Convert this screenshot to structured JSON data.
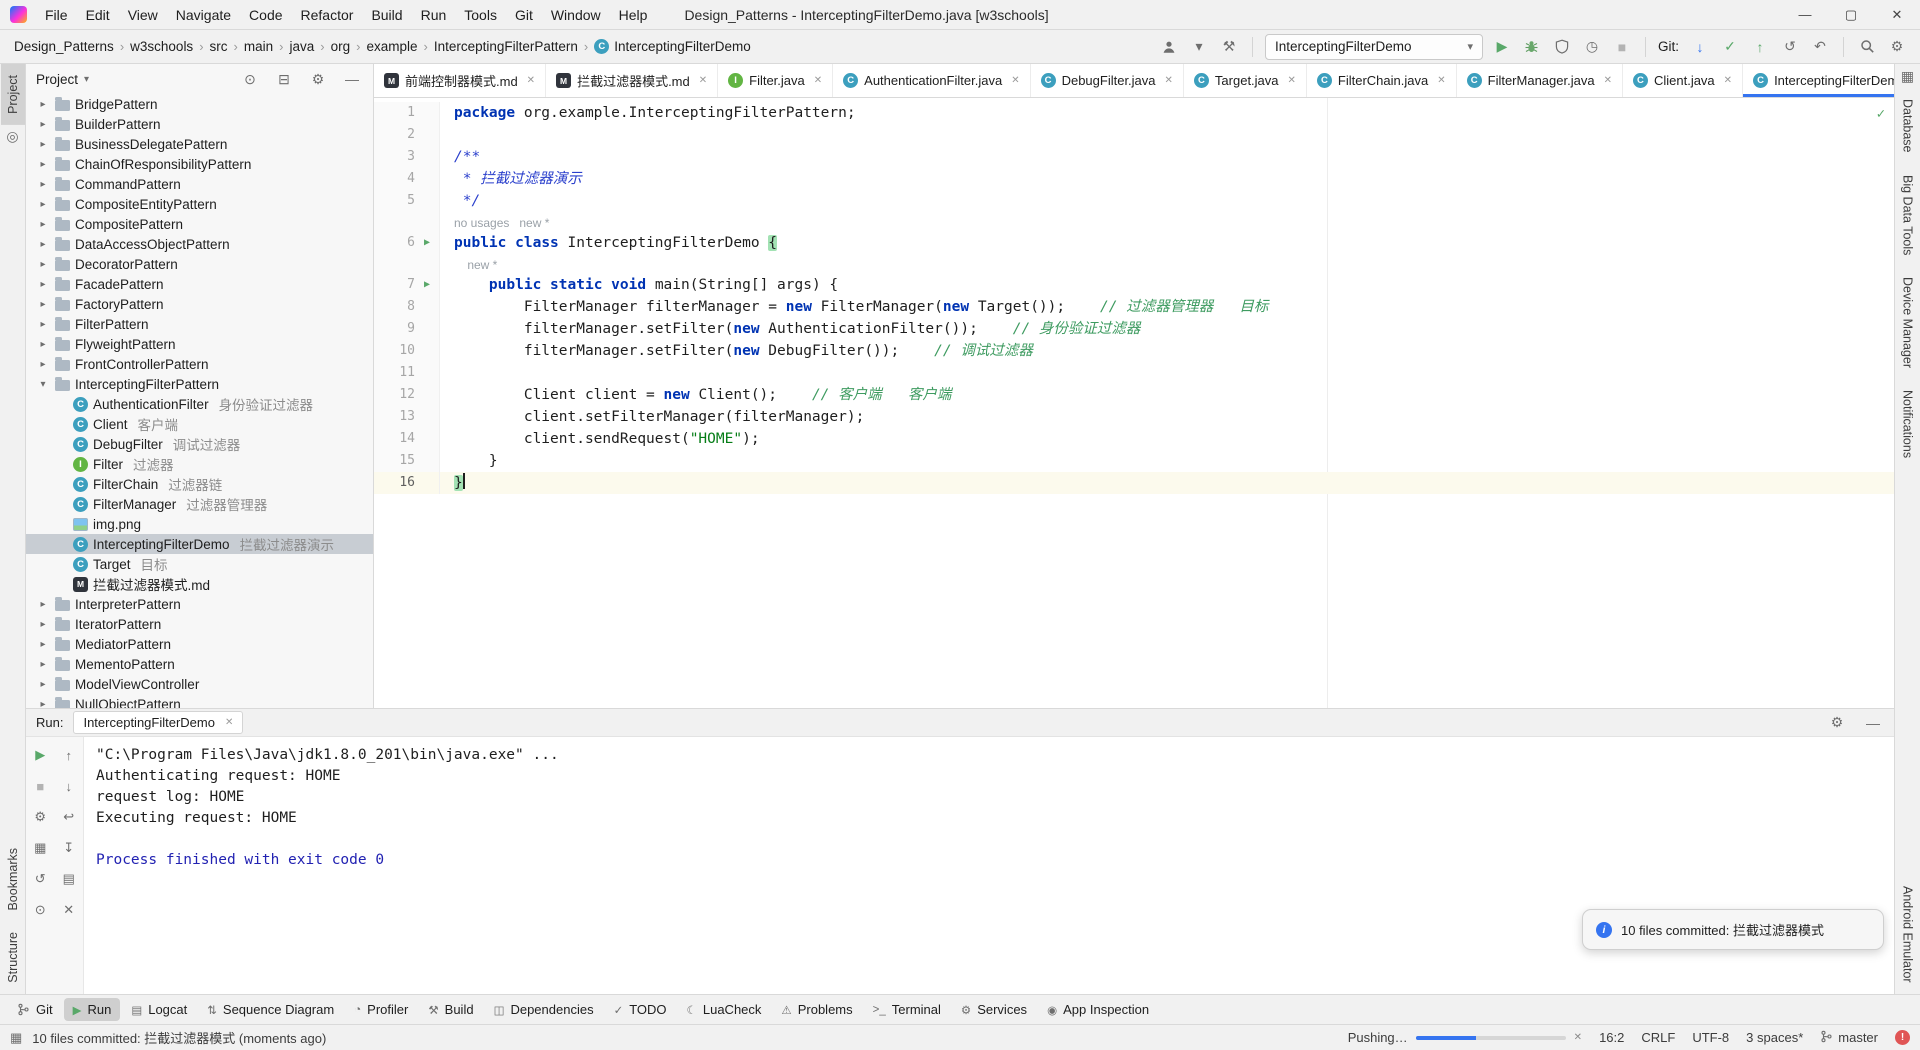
{
  "window": {
    "title": "Design_Patterns - InterceptingFilterDemo.java [w3schools]",
    "menus": [
      "File",
      "Edit",
      "View",
      "Navigate",
      "Code",
      "Refactor",
      "Build",
      "Run",
      "Tools",
      "Git",
      "Window",
      "Help"
    ],
    "controls": [
      {
        "name": "minimize-button",
        "icon": "minimize-icon",
        "glyph": "—"
      },
      {
        "name": "maximize-button",
        "icon": "maximize-icon",
        "glyph": "▢"
      },
      {
        "name": "close-button",
        "icon": "close-icon",
        "glyph": "✕"
      }
    ]
  },
  "toolbar": {
    "breadcrumbs": [
      {
        "label": "Design_Patterns"
      },
      {
        "label": "w3schools"
      },
      {
        "label": "src"
      },
      {
        "label": "main"
      },
      {
        "label": "java"
      },
      {
        "label": "org"
      },
      {
        "label": "example"
      },
      {
        "label": "InterceptingFilterPattern"
      },
      {
        "label": "InterceptingFilterDemo",
        "icon": "class"
      }
    ],
    "run_config": "InterceptingFilterDemo",
    "combo_caret": "▾",
    "git_label": "Git:",
    "icons_profile": [
      {
        "icon": "profile-icon",
        "svg": "person"
      },
      {
        "icon": "caret-down-icon",
        "glyph": "▾"
      },
      {
        "icon": "quick-tools-icon",
        "glyph": "⚒"
      }
    ],
    "icons_run": [
      {
        "icon": "run-button",
        "glyph": "▶",
        "cls": "green"
      },
      {
        "icon": "debug-button",
        "svg": "bug"
      },
      {
        "icon": "coverage-button",
        "svg": "shield"
      },
      {
        "icon": "profiler-button",
        "glyph": "◷"
      },
      {
        "icon": "stop-button",
        "glyph": "■",
        "cls": "dim"
      }
    ],
    "icons_git": [
      {
        "icon": "update-project-icon",
        "glyph": "↓",
        "cls": "blue"
      },
      {
        "icon": "commit-icon",
        "glyph": "✓",
        "cls": "green"
      },
      {
        "icon": "push-icon",
        "glyph": "↑",
        "cls": "green"
      },
      {
        "icon": "history-icon",
        "glyph": "↺"
      },
      {
        "icon": "rollback-icon",
        "glyph": "↶"
      }
    ],
    "icons_end": [
      {
        "icon": "search-icon",
        "svg": "magnifier"
      },
      {
        "icon": "settings-icon",
        "glyph": "⚙"
      }
    ]
  },
  "stripes": {
    "left_top": [
      {
        "label": "Project",
        "selected": true
      },
      {
        "icon": "commit-tool-icon",
        "glyph": "◎"
      }
    ],
    "left_bottom": [
      {
        "label": "Bookmarks"
      },
      {
        "label": "Structure"
      }
    ],
    "right_top": [
      {
        "icon": "build-tool-icon",
        "glyph": "▦"
      },
      {
        "label": "Database"
      },
      {
        "label": "Big Data Tools"
      },
      {
        "label": "Device Manager"
      },
      {
        "label": "Notifications"
      }
    ],
    "right_bottom": [
      {
        "label": "Android Emulator"
      }
    ]
  },
  "project_panel": {
    "header": "Project",
    "header_caret": "▾",
    "header_icons": [
      {
        "icon": "locate-file-icon",
        "glyph": "⊙"
      },
      {
        "icon": "collapse-all-icon",
        "glyph": "⊟"
      },
      {
        "icon": "settings-icon",
        "glyph": "⚙"
      },
      {
        "icon": "hide-panel-icon",
        "glyph": "—"
      }
    ],
    "tree": [
      {
        "kind": "folder",
        "label": "BridgePattern"
      },
      {
        "kind": "folder",
        "label": "BuilderPattern"
      },
      {
        "kind": "folder",
        "label": "BusinessDelegatePattern"
      },
      {
        "kind": "folder",
        "label": "ChainOfResponsibilityPattern"
      },
      {
        "kind": "folder",
        "label": "CommandPattern"
      },
      {
        "kind": "folder",
        "label": "CompositeEntityPattern"
      },
      {
        "kind": "folder",
        "label": "CompositePattern"
      },
      {
        "kind": "folder",
        "label": "DataAccessObjectPattern"
      },
      {
        "kind": "folder",
        "label": "DecoratorPattern"
      },
      {
        "kind": "folder",
        "label": "FacadePattern"
      },
      {
        "kind": "folder",
        "label": "FactoryPattern"
      },
      {
        "kind": "folder",
        "label": "FilterPattern"
      },
      {
        "kind": "folder",
        "label": "FlyweightPattern"
      },
      {
        "kind": "folder",
        "label": "FrontControllerPattern"
      },
      {
        "kind": "folder",
        "label": "InterceptingFilterPattern",
        "expanded": true,
        "children": [
          {
            "kind": "class",
            "label": "AuthenticationFilter",
            "note": "身份验证过滤器"
          },
          {
            "kind": "class",
            "label": "Client",
            "note": "客户端"
          },
          {
            "kind": "class",
            "label": "DebugFilter",
            "note": "调试过滤器"
          },
          {
            "kind": "interface",
            "label": "Filter",
            "note": "过滤器"
          },
          {
            "kind": "class",
            "label": "FilterChain",
            "note": "过滤器链"
          },
          {
            "kind": "class",
            "label": "FilterManager",
            "note": "过滤器管理器"
          },
          {
            "kind": "image",
            "label": "img.png"
          },
          {
            "kind": "class",
            "label": "InterceptingFilterDemo",
            "note": "拦截过滤器演示",
            "selected": true
          },
          {
            "kind": "class",
            "label": "Target",
            "note": "目标"
          },
          {
            "kind": "md",
            "label": "拦截过滤器模式.md"
          }
        ]
      },
      {
        "kind": "folder",
        "label": "InterpreterPattern"
      },
      {
        "kind": "folder",
        "label": "IteratorPattern"
      },
      {
        "kind": "folder",
        "label": "MediatorPattern"
      },
      {
        "kind": "folder",
        "label": "MementoPattern"
      },
      {
        "kind": "folder",
        "label": "ModelViewController"
      },
      {
        "kind": "folder",
        "label": "NullObjectPattern"
      }
    ]
  },
  "editor": {
    "tabs": [
      {
        "icon": "md",
        "label": "前端控制器模式.md"
      },
      {
        "icon": "md",
        "label": "拦截过滤器模式.md"
      },
      {
        "icon": "interface",
        "label": "Filter.java"
      },
      {
        "icon": "class",
        "label": "AuthenticationFilter.java"
      },
      {
        "icon": "class",
        "label": "DebugFilter.java"
      },
      {
        "icon": "class",
        "label": "Target.java"
      },
      {
        "icon": "class",
        "label": "FilterChain.java"
      },
      {
        "icon": "class",
        "label": "FilterManager.java"
      },
      {
        "icon": "class",
        "label": "Client.java"
      },
      {
        "icon": "class",
        "label": "InterceptingFilterDemo.java",
        "active": true
      }
    ],
    "tab_close_glyph": "✕",
    "more_glyph": "⋮",
    "inspection_glyph": "✓",
    "lines": [
      {
        "n": 1,
        "tokens": [
          [
            "package",
            "kw"
          ],
          [
            " org.example.InterceptingFilterPattern;",
            "pl"
          ]
        ]
      },
      {
        "n": 2,
        "tokens": []
      },
      {
        "n": 3,
        "tokens": [
          [
            "/**",
            "doc"
          ]
        ]
      },
      {
        "n": 4,
        "tokens": [
          [
            " * 拦截过滤器演示",
            "doc"
          ]
        ]
      },
      {
        "n": 5,
        "tokens": [
          [
            " */",
            "doc"
          ]
        ]
      },
      {
        "n": 6,
        "run": true,
        "inlay": "no usages   new *",
        "tokens": [
          [
            "public",
            "kw"
          ],
          [
            " ",
            "pl"
          ],
          [
            "class",
            "kw"
          ],
          [
            " InterceptingFilterDemo ",
            "pl"
          ],
          [
            "{",
            "brace"
          ]
        ]
      },
      {
        "n": 7,
        "run": true,
        "inlay": "    new *",
        "tokens": [
          [
            "    ",
            "pl"
          ],
          [
            "public",
            "kw"
          ],
          [
            " ",
            "pl"
          ],
          [
            "static",
            "kw"
          ],
          [
            " ",
            "pl"
          ],
          [
            "void",
            "kw"
          ],
          [
            " main(String[] args) {",
            "pl"
          ]
        ]
      },
      {
        "n": 8,
        "tokens": [
          [
            "        FilterManager filterManager = ",
            "pl"
          ],
          [
            "new",
            "kw"
          ],
          [
            " FilterManager(",
            "pl"
          ],
          [
            "new",
            "kw"
          ],
          [
            " Target());",
            "pl"
          ],
          [
            "    ",
            "pl"
          ],
          [
            "// 过滤器管理器   目标",
            "cmt"
          ]
        ]
      },
      {
        "n": 9,
        "tokens": [
          [
            "        filterManager.setFilter(",
            "pl"
          ],
          [
            "new",
            "kw"
          ],
          [
            " AuthenticationFilter());",
            "pl"
          ],
          [
            "    ",
            "pl"
          ],
          [
            "// 身份验证过滤器",
            "cmt"
          ]
        ]
      },
      {
        "n": 10,
        "tokens": [
          [
            "        filterManager.setFilter(",
            "pl"
          ],
          [
            "new",
            "kw"
          ],
          [
            " DebugFilter());",
            "pl"
          ],
          [
            "    ",
            "pl"
          ],
          [
            "// 调试过滤器",
            "cmt"
          ]
        ]
      },
      {
        "n": 11,
        "tokens": []
      },
      {
        "n": 12,
        "tokens": [
          [
            "        Client client = ",
            "pl"
          ],
          [
            "new",
            "kw"
          ],
          [
            " Client();",
            "pl"
          ],
          [
            "    ",
            "pl"
          ],
          [
            "// 客户端   客户端",
            "cmt"
          ]
        ]
      },
      {
        "n": 13,
        "tokens": [
          [
            "        client.setFilterManager(filterManager);",
            "pl"
          ]
        ]
      },
      {
        "n": 14,
        "tokens": [
          [
            "        client.sendRequest(",
            "pl"
          ],
          [
            "\"HOME\"",
            "str"
          ],
          [
            ");",
            "pl"
          ]
        ]
      },
      {
        "n": 15,
        "tokens": [
          [
            "    }",
            "pl"
          ]
        ]
      },
      {
        "n": 16,
        "active": true,
        "tokens": [
          [
            "}",
            "brace"
          ]
        ]
      }
    ]
  },
  "run_panel": {
    "label": "Run:",
    "tab": "InterceptingFilterDemo",
    "close_glyph": "✕",
    "header_icons": [
      {
        "icon": "settings-icon",
        "glyph": "⚙"
      },
      {
        "icon": "hide-panel-icon",
        "glyph": "—"
      }
    ],
    "tools": [
      {
        "icon": "rerun-icon",
        "glyph": "▶",
        "cls": "green"
      },
      {
        "icon": "up-stack-trace-icon",
        "glyph": "↑"
      },
      {
        "icon": "stop-icon",
        "glyph": "■",
        "cls": "dim"
      },
      {
        "icon": "down-stack-trace-icon",
        "glyph": "↓"
      },
      {
        "icon": "edit-configuration-icon",
        "glyph": "⚙"
      },
      {
        "icon": "soft-wrap-icon",
        "glyph": "↩"
      },
      {
        "icon": "restore-layout-icon",
        "glyph": "▦"
      },
      {
        "icon": "scroll-to-end-icon",
        "glyph": "↧"
      },
      {
        "icon": "history-icon",
        "glyph": "↺"
      },
      {
        "icon": "print-icon",
        "glyph": "▤"
      },
      {
        "icon": "pin-icon",
        "glyph": "⊙"
      },
      {
        "icon": "clear-all-icon",
        "glyph": "✕"
      }
    ],
    "console": [
      {
        "text": "\"C:\\Program Files\\Java\\jdk1.8.0_201\\bin\\java.exe\" ...",
        "cls": "cmd"
      },
      {
        "text": "Authenticating request: HOME",
        "cls": "out"
      },
      {
        "text": "request log: HOME",
        "cls": "out"
      },
      {
        "text": "Executing request: HOME",
        "cls": "out"
      },
      {
        "text": "",
        "cls": "out"
      },
      {
        "text": "Process finished with exit code 0",
        "cls": "exit"
      }
    ]
  },
  "tool_window_bar": [
    {
      "label": "Git",
      "icon": "git-branch-icon",
      "svg": "branch"
    },
    {
      "label": "Run",
      "icon": "run-tool-icon",
      "glyph": "▶",
      "cls": "green",
      "active": true
    },
    {
      "label": "Logcat",
      "icon": "logcat-icon",
      "glyph": "▤"
    },
    {
      "label": "Sequence Diagram",
      "icon": "sequence-diagram-icon",
      "glyph": "⇅"
    },
    {
      "label": "Profiler",
      "icon": "profiler-icon",
      "glyph": "◔"
    },
    {
      "label": "Build",
      "icon": "build-icon",
      "glyph": "⚒"
    },
    {
      "label": "Dependencies",
      "icon": "dependencies-icon",
      "glyph": "◫"
    },
    {
      "label": "TODO",
      "icon": "todo-icon",
      "glyph": "✓"
    },
    {
      "label": "LuaCheck",
      "icon": "luacheck-icon",
      "glyph": "☾"
    },
    {
      "label": "Problems",
      "icon": "problems-icon",
      "glyph": "⚠"
    },
    {
      "label": "Terminal",
      "icon": "terminal-icon",
      "glyph": ">_"
    },
    {
      "label": "Services",
      "icon": "services-icon",
      "glyph": "⚙"
    },
    {
      "label": "App Inspection",
      "icon": "app-inspection-icon",
      "glyph": "◉"
    }
  ],
  "status_bar": {
    "switcher_glyph": "▦",
    "message": "10 files committed: 拦截过滤器模式 (moments ago)",
    "pushing": "Pushing…",
    "progress_pct": 40,
    "close_glyph": "✕",
    "items": [
      {
        "label": "16:2"
      },
      {
        "label": "CRLF"
      },
      {
        "label": "UTF-8"
      },
      {
        "label": "3 spaces*"
      },
      {
        "label": "master",
        "icon": "git-branch-icon",
        "svg": "branch"
      }
    ],
    "error_badge": "!"
  },
  "notification": {
    "text": "10 files committed: 拦截过滤器模式"
  }
}
